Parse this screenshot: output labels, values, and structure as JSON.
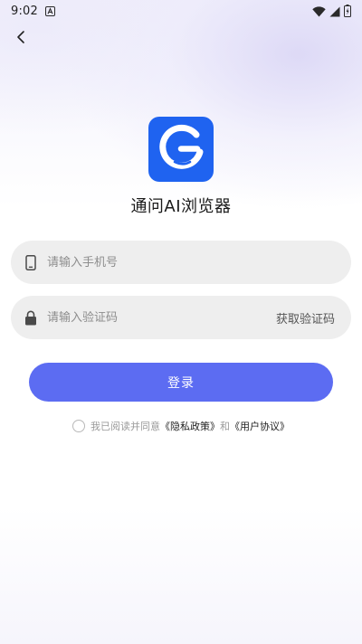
{
  "status_bar": {
    "time": "9:02",
    "icons": [
      "a-notification-icon",
      "wifi-icon",
      "cell-signal-icon",
      "battery-icon"
    ]
  },
  "header": {
    "back_icon": "chevron-left-icon"
  },
  "app": {
    "name": "通问AI浏览器",
    "logo_icon": "g-logo-icon",
    "logo_color": "#1f63f0"
  },
  "form": {
    "phone_placeholder": "请输入手机号",
    "phone_value": "",
    "phone_icon": "phone-icon",
    "code_placeholder": "请输入验证码",
    "code_value": "",
    "code_icon": "lock-icon",
    "get_code_label": "获取验证码",
    "login_label": "登录"
  },
  "agreement": {
    "prefix": "我已阅读并同意",
    "privacy_link": "《隐私政策》",
    "conjunction": "和",
    "terms_link": "《用户协议》",
    "checked": false
  },
  "colors": {
    "primary": "#5c6cf2",
    "field_bg": "#eeeeee"
  }
}
